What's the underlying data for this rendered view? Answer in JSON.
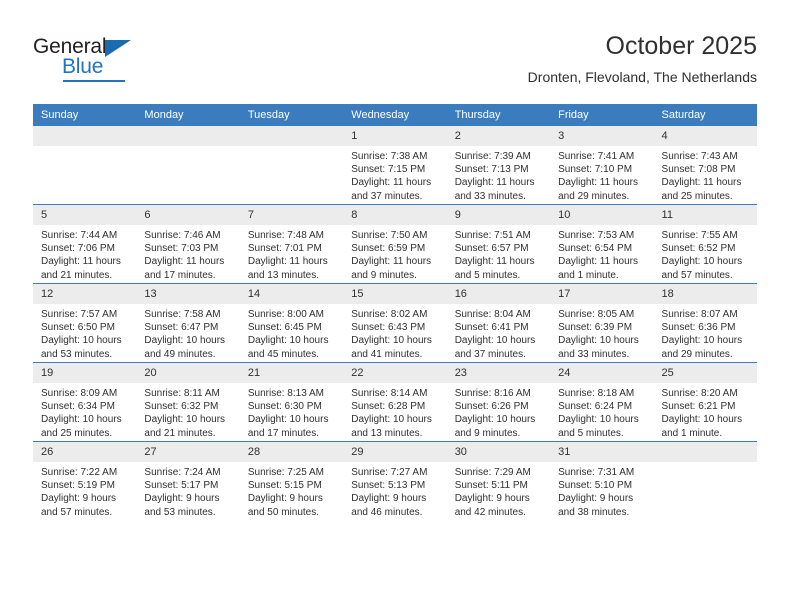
{
  "brand": {
    "name_top": "General",
    "name_bottom": "Blue",
    "accent_color": "#2175c0"
  },
  "header": {
    "title": "October 2025",
    "subtitle": "Dronten, Flevoland, The Netherlands"
  },
  "theme": {
    "header_blue": "#3b7cbe",
    "daynum_band": "#ececec",
    "text": "#303030"
  },
  "weekday_headers": [
    "Sunday",
    "Monday",
    "Tuesday",
    "Wednesday",
    "Thursday",
    "Friday",
    "Saturday"
  ],
  "weeks": [
    [
      {
        "day": "",
        "sunrise": "",
        "sunset": "",
        "daylight": ""
      },
      {
        "day": "",
        "sunrise": "",
        "sunset": "",
        "daylight": ""
      },
      {
        "day": "",
        "sunrise": "",
        "sunset": "",
        "daylight": ""
      },
      {
        "day": "1",
        "sunrise": "Sunrise: 7:38 AM",
        "sunset": "Sunset: 7:15 PM",
        "daylight": "Daylight: 11 hours and 37 minutes."
      },
      {
        "day": "2",
        "sunrise": "Sunrise: 7:39 AM",
        "sunset": "Sunset: 7:13 PM",
        "daylight": "Daylight: 11 hours and 33 minutes."
      },
      {
        "day": "3",
        "sunrise": "Sunrise: 7:41 AM",
        "sunset": "Sunset: 7:10 PM",
        "daylight": "Daylight: 11 hours and 29 minutes."
      },
      {
        "day": "4",
        "sunrise": "Sunrise: 7:43 AM",
        "sunset": "Sunset: 7:08 PM",
        "daylight": "Daylight: 11 hours and 25 minutes."
      }
    ],
    [
      {
        "day": "5",
        "sunrise": "Sunrise: 7:44 AM",
        "sunset": "Sunset: 7:06 PM",
        "daylight": "Daylight: 11 hours and 21 minutes."
      },
      {
        "day": "6",
        "sunrise": "Sunrise: 7:46 AM",
        "sunset": "Sunset: 7:03 PM",
        "daylight": "Daylight: 11 hours and 17 minutes."
      },
      {
        "day": "7",
        "sunrise": "Sunrise: 7:48 AM",
        "sunset": "Sunset: 7:01 PM",
        "daylight": "Daylight: 11 hours and 13 minutes."
      },
      {
        "day": "8",
        "sunrise": "Sunrise: 7:50 AM",
        "sunset": "Sunset: 6:59 PM",
        "daylight": "Daylight: 11 hours and 9 minutes."
      },
      {
        "day": "9",
        "sunrise": "Sunrise: 7:51 AM",
        "sunset": "Sunset: 6:57 PM",
        "daylight": "Daylight: 11 hours and 5 minutes."
      },
      {
        "day": "10",
        "sunrise": "Sunrise: 7:53 AM",
        "sunset": "Sunset: 6:54 PM",
        "daylight": "Daylight: 11 hours and 1 minute."
      },
      {
        "day": "11",
        "sunrise": "Sunrise: 7:55 AM",
        "sunset": "Sunset: 6:52 PM",
        "daylight": "Daylight: 10 hours and 57 minutes."
      }
    ],
    [
      {
        "day": "12",
        "sunrise": "Sunrise: 7:57 AM",
        "sunset": "Sunset: 6:50 PM",
        "daylight": "Daylight: 10 hours and 53 minutes."
      },
      {
        "day": "13",
        "sunrise": "Sunrise: 7:58 AM",
        "sunset": "Sunset: 6:47 PM",
        "daylight": "Daylight: 10 hours and 49 minutes."
      },
      {
        "day": "14",
        "sunrise": "Sunrise: 8:00 AM",
        "sunset": "Sunset: 6:45 PM",
        "daylight": "Daylight: 10 hours and 45 minutes."
      },
      {
        "day": "15",
        "sunrise": "Sunrise: 8:02 AM",
        "sunset": "Sunset: 6:43 PM",
        "daylight": "Daylight: 10 hours and 41 minutes."
      },
      {
        "day": "16",
        "sunrise": "Sunrise: 8:04 AM",
        "sunset": "Sunset: 6:41 PM",
        "daylight": "Daylight: 10 hours and 37 minutes."
      },
      {
        "day": "17",
        "sunrise": "Sunrise: 8:05 AM",
        "sunset": "Sunset: 6:39 PM",
        "daylight": "Daylight: 10 hours and 33 minutes."
      },
      {
        "day": "18",
        "sunrise": "Sunrise: 8:07 AM",
        "sunset": "Sunset: 6:36 PM",
        "daylight": "Daylight: 10 hours and 29 minutes."
      }
    ],
    [
      {
        "day": "19",
        "sunrise": "Sunrise: 8:09 AM",
        "sunset": "Sunset: 6:34 PM",
        "daylight": "Daylight: 10 hours and 25 minutes."
      },
      {
        "day": "20",
        "sunrise": "Sunrise: 8:11 AM",
        "sunset": "Sunset: 6:32 PM",
        "daylight": "Daylight: 10 hours and 21 minutes."
      },
      {
        "day": "21",
        "sunrise": "Sunrise: 8:13 AM",
        "sunset": "Sunset: 6:30 PM",
        "daylight": "Daylight: 10 hours and 17 minutes."
      },
      {
        "day": "22",
        "sunrise": "Sunrise: 8:14 AM",
        "sunset": "Sunset: 6:28 PM",
        "daylight": "Daylight: 10 hours and 13 minutes."
      },
      {
        "day": "23",
        "sunrise": "Sunrise: 8:16 AM",
        "sunset": "Sunset: 6:26 PM",
        "daylight": "Daylight: 10 hours and 9 minutes."
      },
      {
        "day": "24",
        "sunrise": "Sunrise: 8:18 AM",
        "sunset": "Sunset: 6:24 PM",
        "daylight": "Daylight: 10 hours and 5 minutes."
      },
      {
        "day": "25",
        "sunrise": "Sunrise: 8:20 AM",
        "sunset": "Sunset: 6:21 PM",
        "daylight": "Daylight: 10 hours and 1 minute."
      }
    ],
    [
      {
        "day": "26",
        "sunrise": "Sunrise: 7:22 AM",
        "sunset": "Sunset: 5:19 PM",
        "daylight": "Daylight: 9 hours and 57 minutes."
      },
      {
        "day": "27",
        "sunrise": "Sunrise: 7:24 AM",
        "sunset": "Sunset: 5:17 PM",
        "daylight": "Daylight: 9 hours and 53 minutes."
      },
      {
        "day": "28",
        "sunrise": "Sunrise: 7:25 AM",
        "sunset": "Sunset: 5:15 PM",
        "daylight": "Daylight: 9 hours and 50 minutes."
      },
      {
        "day": "29",
        "sunrise": "Sunrise: 7:27 AM",
        "sunset": "Sunset: 5:13 PM",
        "daylight": "Daylight: 9 hours and 46 minutes."
      },
      {
        "day": "30",
        "sunrise": "Sunrise: 7:29 AM",
        "sunset": "Sunset: 5:11 PM",
        "daylight": "Daylight: 9 hours and 42 minutes."
      },
      {
        "day": "31",
        "sunrise": "Sunrise: 7:31 AM",
        "sunset": "Sunset: 5:10 PM",
        "daylight": "Daylight: 9 hours and 38 minutes."
      },
      {
        "day": "",
        "sunrise": "",
        "sunset": "",
        "daylight": ""
      }
    ]
  ]
}
